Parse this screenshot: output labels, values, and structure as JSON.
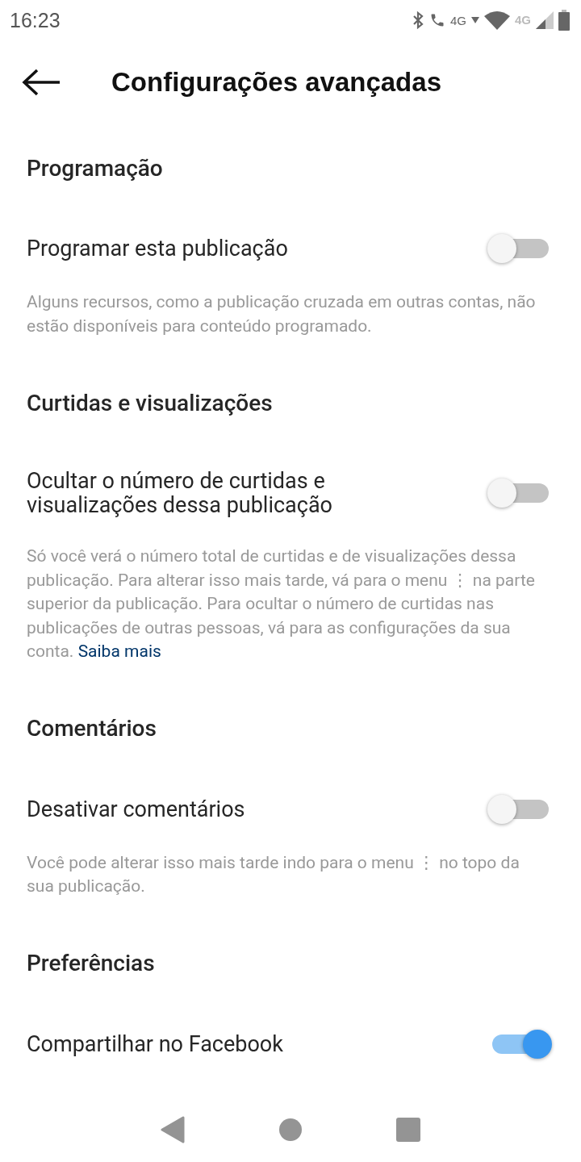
{
  "status_bar": {
    "time": "16:23",
    "call_network": "4G",
    "signal_network": "4G"
  },
  "header": {
    "title": "Configurações avançadas"
  },
  "sections": [
    {
      "title": "Programação",
      "setting": {
        "label": "Programar esta publicação",
        "on": false
      },
      "description": "Alguns recursos, como a publicação cruzada em outras contas, não estão disponíveis para conteúdo programado."
    },
    {
      "title": "Curtidas e visualizações",
      "setting": {
        "label": "Ocultar o número de curtidas e visualizações dessa publicação",
        "on": false
      },
      "description": "Só você verá o número total de curtidas e de visualizações dessa publicação. Para alterar isso mais tarde, vá para o menu ⋮ na parte superior da publicação. Para ocultar o número de curtidas nas publicações de outras pessoas, vá para as configurações da sua conta.",
      "link": "Saiba mais"
    },
    {
      "title": "Comentários",
      "setting": {
        "label": "Desativar comentários",
        "on": false
      },
      "description": "Você pode alterar isso mais tarde indo para o menu ⋮ no topo da sua publicação."
    },
    {
      "title": "Preferências",
      "setting": {
        "label": "Compartilhar no Facebook",
        "on": true
      }
    }
  ]
}
